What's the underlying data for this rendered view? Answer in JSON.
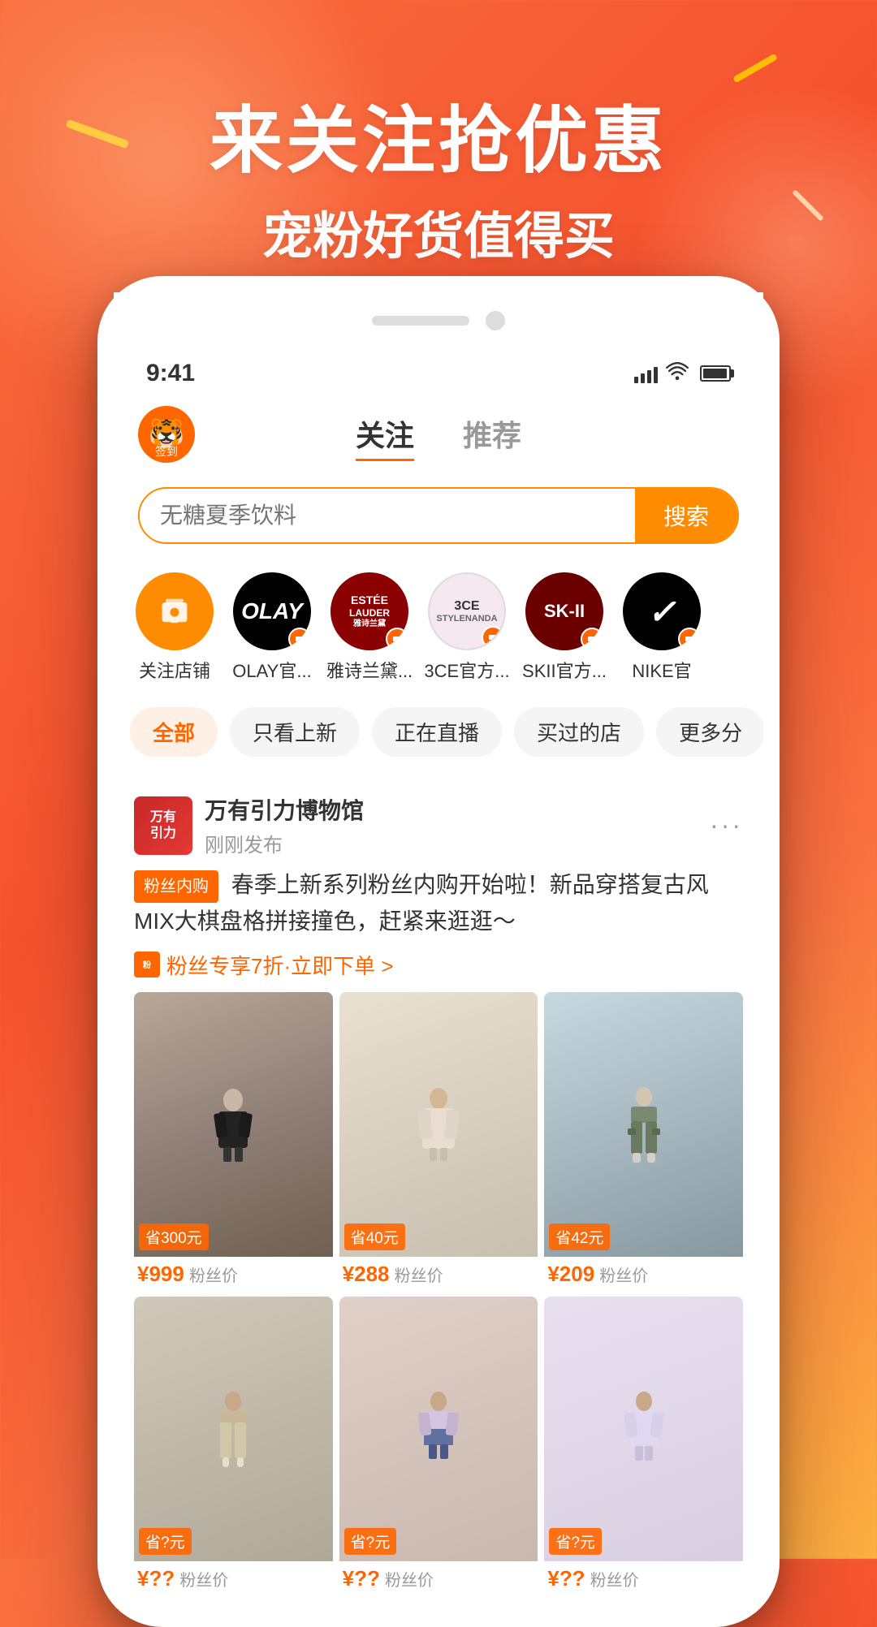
{
  "background": {
    "gradient_start": "#f97040",
    "gradient_end": "#fbb040"
  },
  "hero": {
    "title": "来关注抢优惠",
    "subtitle": "宠粉好货值得买"
  },
  "phone": {
    "status_bar": {
      "time": "9:41",
      "signal": "●●●",
      "wifi": "WiFi",
      "battery": "100"
    },
    "header": {
      "sign_in_label": "签到",
      "tabs": [
        {
          "label": "关注",
          "active": true
        },
        {
          "label": "推荐",
          "active": false
        }
      ]
    },
    "search": {
      "placeholder": "无糖夏季饮料",
      "button_label": "搜索"
    },
    "stores": [
      {
        "name": "关注店铺",
        "type": "follow"
      },
      {
        "name": "OLAY官...",
        "type": "olay"
      },
      {
        "name": "雅诗兰黛...",
        "type": "estee"
      },
      {
        "name": "3CE官方...",
        "type": "3ce"
      },
      {
        "name": "SKII官方...",
        "type": "skii"
      },
      {
        "name": "NIKE官",
        "type": "nike"
      }
    ],
    "filter_tabs": [
      {
        "label": "全部",
        "active": true
      },
      {
        "label": "只看上新",
        "active": false
      },
      {
        "label": "正在直播",
        "active": false
      },
      {
        "label": "买过的店",
        "active": false
      },
      {
        "label": "更多分",
        "active": false
      }
    ],
    "feed": {
      "store_name": "万有引力博物馆",
      "post_time": "刚刚发布",
      "fan_badge": "粉丝内购",
      "content": "春季上新系列粉丝内购开始啦！新品穿搭复古风MIX大棋盘格拼接撞色，赶紧来逛逛～",
      "discount_text": "粉丝专享7折·立即下单 >",
      "products": [
        {
          "save": "省300元",
          "price": "¥999",
          "label": "粉丝价",
          "bg_color": "#e8e0d8"
        },
        {
          "save": "省40元",
          "price": "¥288",
          "label": "粉丝价",
          "bg_color": "#f0ece8"
        },
        {
          "save": "省42元",
          "price": "¥209",
          "label": "粉丝价",
          "bg_color": "#d4dce0"
        },
        {
          "save": "省?元",
          "price": "¥??",
          "label": "粉丝价",
          "bg_color": "#c8c0b8"
        },
        {
          "save": "省?元",
          "price": "¥??",
          "label": "粉丝价",
          "bg_color": "#d8d0c8"
        },
        {
          "save": "省?元",
          "price": "¥??",
          "label": "粉丝价",
          "bg_color": "#e0d8d8"
        }
      ]
    }
  }
}
